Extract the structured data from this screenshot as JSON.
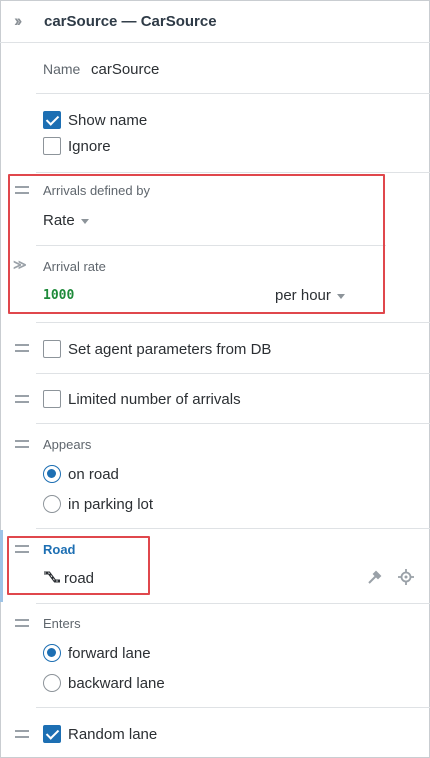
{
  "header": {
    "title": "carSource — CarSource",
    "collapse_icon": "double-chevron-right-icon"
  },
  "name": {
    "label": "Name",
    "value": "carSource"
  },
  "show_name": {
    "label": "Show name",
    "checked": true
  },
  "ignore": {
    "label": "Ignore",
    "checked": false
  },
  "arrivals_defined_by": {
    "label": "Arrivals defined by",
    "value": "Rate"
  },
  "arrival_rate": {
    "label": "Arrival rate",
    "value": "1000",
    "unit": "per hour"
  },
  "set_agent_params": {
    "label": "Set agent parameters from DB",
    "checked": false
  },
  "limited_arrivals": {
    "label": "Limited number of arrivals",
    "checked": false
  },
  "appears": {
    "label": "Appears",
    "options": [
      "on road",
      "in parking lot"
    ],
    "selected": "on road"
  },
  "road": {
    "label": "Road",
    "value": "road"
  },
  "enters": {
    "label": "Enters",
    "options": [
      "forward lane",
      "backward lane"
    ],
    "selected": "forward lane"
  },
  "random_lane": {
    "label": "Random lane",
    "checked": true
  },
  "colors": {
    "accent": "#1d6fb3",
    "highlight": "#e0474c",
    "code_green": "#1e8a3a"
  }
}
